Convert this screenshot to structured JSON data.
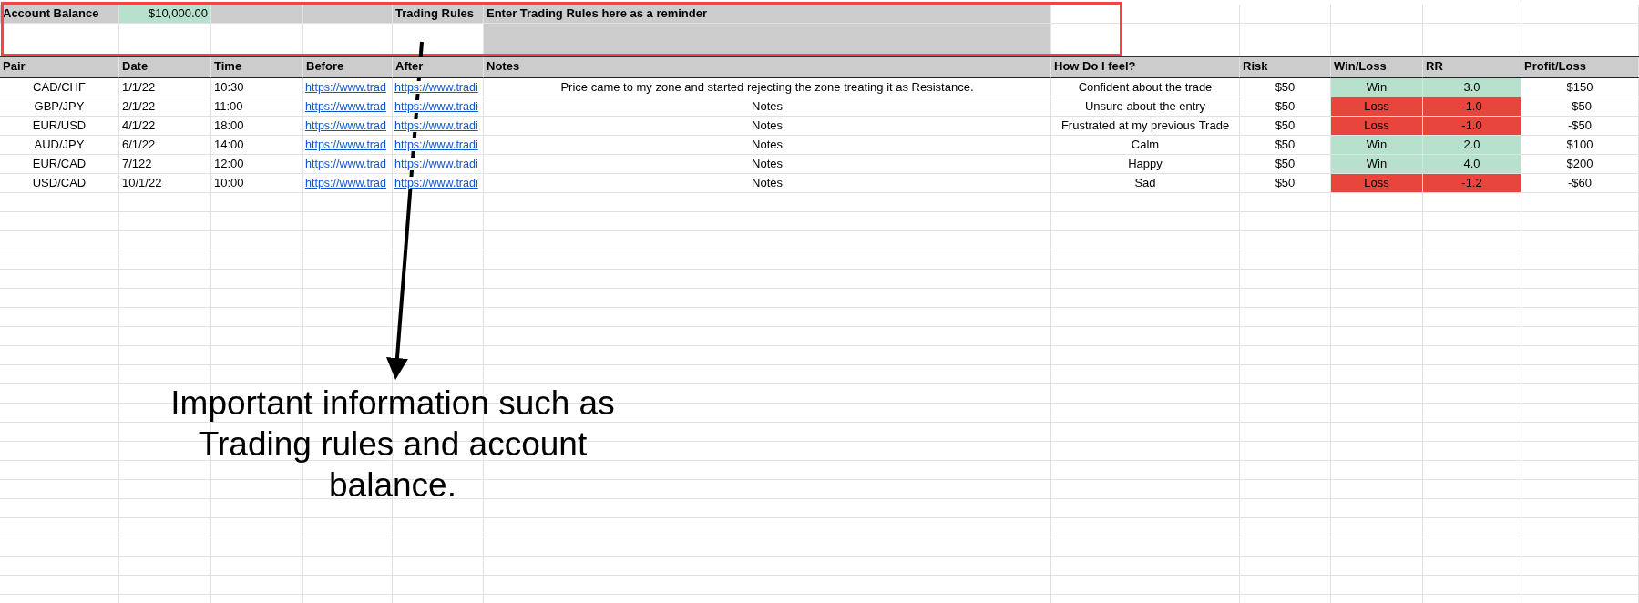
{
  "summary": {
    "account_label": "Account Balance",
    "account_value": "$10,000.00",
    "rules_label": "Trading Rules",
    "rules_text": "Enter Trading Rules here as a reminder"
  },
  "table": {
    "columns": [
      "Pair",
      "Date",
      "Time",
      "Before",
      "After",
      "Notes",
      "How Do I feel?",
      "Risk",
      "Win/Loss",
      "RR",
      "Profit/Loss"
    ],
    "rows": [
      {
        "pair": "CAD/CHF",
        "date": "1/1/22",
        "time": "10:30",
        "before": "https://www.trad",
        "after": "https://www.tradi",
        "notes": "Price came to my zone and started rejecting the zone treating it as Resistance.",
        "feel": "Confident about the trade",
        "risk": "$50",
        "result": "Win",
        "color": "#b7e1cd",
        "rr": "3.0",
        "pl": "$150"
      },
      {
        "pair": "GBP/JPY",
        "date": "2/1/22",
        "time": "11:00",
        "before": "https://www.trad",
        "after": "https://www.tradi",
        "notes": "Notes",
        "feel": "Unsure about the entry",
        "risk": "$50",
        "result": "Loss",
        "color": "#e8453c",
        "rr": "-1.0",
        "pl": "-$50"
      },
      {
        "pair": "EUR/USD",
        "date": "4/1/22",
        "time": "18:00",
        "before": "https://www.trad",
        "after": "https://www.tradi",
        "notes": "Notes",
        "feel": "Frustrated at my previous Trade",
        "risk": "$50",
        "result": "Loss",
        "color": "#e8453c",
        "rr": "-1.0",
        "pl": "-$50"
      },
      {
        "pair": "AUD/JPY",
        "date": "6/1/22",
        "time": "14:00",
        "before": "https://www.trad",
        "after": "https://www.tradi",
        "notes": "Notes",
        "feel": "Calm",
        "risk": "$50",
        "result": "Win",
        "color": "#b7e1cd",
        "rr": "2.0",
        "pl": "$100"
      },
      {
        "pair": "EUR/CAD",
        "date": "7/122",
        "time": "12:00",
        "before": "https://www.trad",
        "after": "https://www.tradi",
        "notes": "Notes",
        "feel": "Happy",
        "risk": "$50",
        "result": "Win",
        "color": "#b7e1cd",
        "rr": "4.0",
        "pl": "$200"
      },
      {
        "pair": "USD/CAD",
        "date": "10/1/22",
        "time": "10:00",
        "before": "https://www.trad",
        "after": "https://www.tradi",
        "notes": "Notes",
        "feel": "Sad",
        "risk": "$50",
        "result": "Loss",
        "color": "#e8453c",
        "rr": "-1.2",
        "pl": "-$60"
      }
    ]
  },
  "annotation": {
    "text": "Important information such as Trading rules and account balance."
  }
}
